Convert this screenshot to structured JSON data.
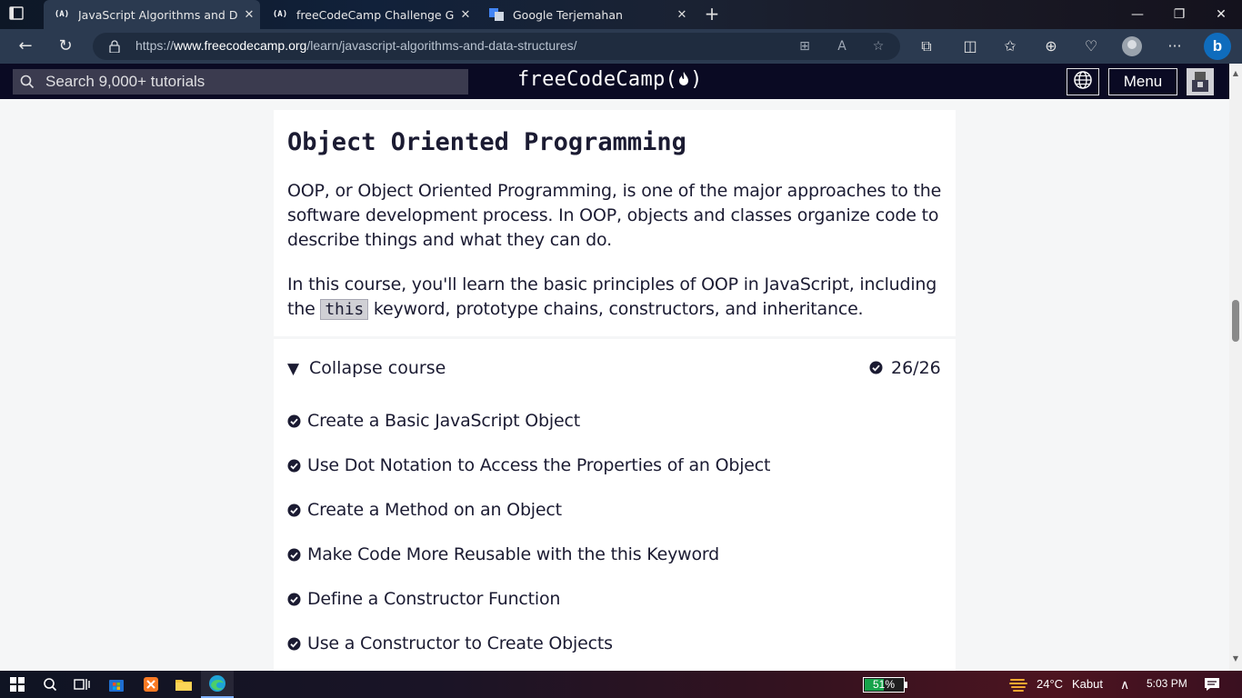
{
  "browser": {
    "tabs": [
      {
        "title": "JavaScript Algorithms and Data Structures",
        "favicon": "(A)",
        "active": true
      },
      {
        "title": "freeCodeCamp Challenge Guide: ...",
        "favicon": "(A)",
        "active": false
      },
      {
        "title": "Google Terjemahan",
        "favicon": "translate-icon",
        "active": false
      }
    ],
    "url_scheme": "https://",
    "url_host": "www.freecodecamp.org",
    "url_path": "/learn/javascript-algorithms-and-data-structures/"
  },
  "fcc_header": {
    "search_placeholder": "Search 9,000+ tutorials",
    "logo_text": "freeCodeCamp(",
    "logo_close": ")",
    "menu_label": "Menu"
  },
  "intro": {
    "title": "Object Oriented Programming",
    "paragraph1": "OOP, or Object Oriented Programming, is one of the major approaches to the software development process. In OOP, objects and classes organize code to describe things and what they can do.",
    "paragraph2_before": "In this course, you'll learn the basic principles of OOP in JavaScript, including the ",
    "paragraph2_code": "this",
    "paragraph2_after": " keyword, prototype chains, constructors, and inheritance."
  },
  "course": {
    "collapse_label": "Collapse course",
    "completed_count": "26/26",
    "lessons": [
      "Create a Basic JavaScript Object",
      "Use Dot Notation to Access the Properties of an Object",
      "Create a Method on an Object",
      "Make Code More Reusable with the this Keyword",
      "Define a Constructor Function",
      "Use a Constructor to Create Objects"
    ]
  },
  "taskbar": {
    "battery_text": "51%",
    "battery_level": 0.51,
    "temperature": "24°C",
    "weather": "Kabut",
    "time": "5:03 PM"
  },
  "colors": {
    "fcc_dark": "#0a0a23",
    "fcc_search_bg": "#3b3b4f",
    "text_primary": "#1b1b32",
    "battery_green": "#16a34a"
  }
}
